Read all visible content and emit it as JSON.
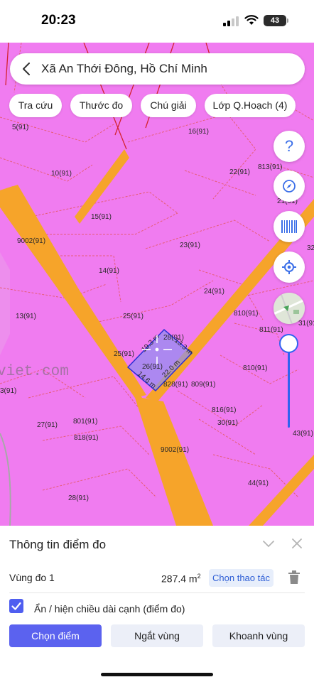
{
  "status_bar": {
    "time": "20:23",
    "battery": "43",
    "icons": [
      "signal-icon",
      "wifi-icon",
      "battery-icon"
    ]
  },
  "search": {
    "location": "Xã An Thới Đông, Hồ Chí Minh",
    "back_icon": "chevron-left-icon"
  },
  "chips": [
    {
      "label": "Tra cứu"
    },
    {
      "label": "Thước đo"
    },
    {
      "label": "Chú giải"
    },
    {
      "label": "Lớp Q.Hoạch (4)"
    }
  ],
  "side_buttons": [
    {
      "icon": "help-icon"
    },
    {
      "icon": "compass-icon"
    },
    {
      "icon": "barcode-icon"
    },
    {
      "icon": "locate-icon"
    },
    {
      "icon": "map-type-thumbnail"
    }
  ],
  "map": {
    "colors": {
      "land": "#f07cf0",
      "road": "#f6a42a",
      "parcel_line": "#e55a6a",
      "boundary": "#d4232f",
      "measure_fill": "#8f8df0",
      "measure_stroke": "#2b2fd6"
    },
    "watermark": "viet.com",
    "parcel_labels": [
      "5(91)",
      "16(91)",
      "10(91)",
      "22(91)",
      "813(91)",
      "21(91)",
      "15(91)",
      "9002(91)",
      "23(91)",
      "32",
      "14(91)",
      "24(91)",
      "13(91)",
      "25(91)",
      "810(91)",
      "31(91)",
      "811(91)",
      "25(91)",
      "28(91)",
      "810(91)",
      "3(91)",
      "828(91)",
      "809(91)",
      "816(91)",
      "27(91)",
      "801(91)",
      "30(91)",
      "818(91)",
      "43(91)",
      "9002(91)",
      "44(91)",
      "28(91)",
      "26(91)"
    ],
    "measure_edges": [
      "19.3 m",
      "13.3 m",
      "22.0 m",
      "14.6 m"
    ]
  },
  "panel": {
    "title": "Thông tin điểm đo",
    "collapse_icon": "chevron-down-icon",
    "close_icon": "close-icon",
    "zone_name": "Vùng đo 1",
    "zone_area": "287.4 m",
    "zone_unit_exp": "2",
    "action_label": "Chọn thao tác",
    "trash_icon": "trash-icon",
    "checkbox_checked": true,
    "checkbox_label": "Ẩn / hiện chiều dài cạnh (điểm đo)",
    "buttons": [
      {
        "label": "Chọn điểm"
      },
      {
        "label": "Ngắt vùng"
      },
      {
        "label": "Khoanh vùng"
      }
    ]
  }
}
